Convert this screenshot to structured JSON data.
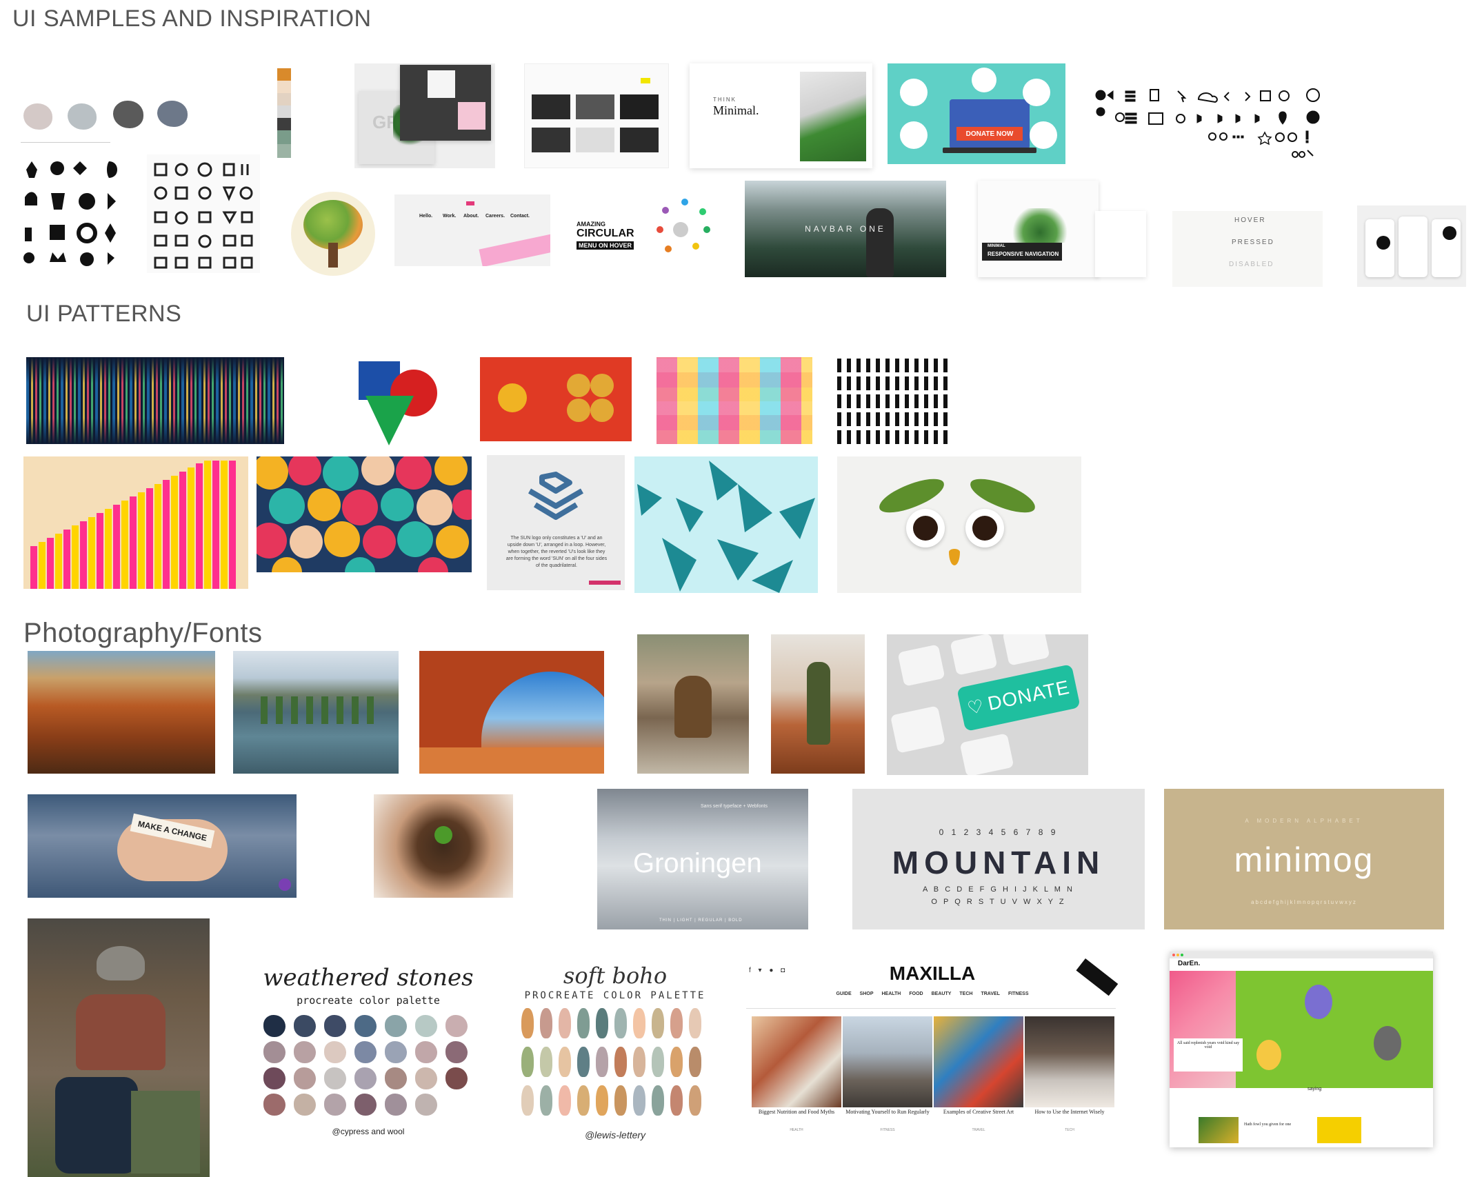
{
  "sections": {
    "samples": "UI SAMPLES AND INSPIRATION",
    "patterns": "UI PATTERNS",
    "photo": "Photography/Fonts"
  },
  "samples": {
    "minimal_title": "Minimal.",
    "minimal_kicker": "THINK",
    "donate_now": "DONATE NOW",
    "circular_menu": [
      "AMAZING",
      "CIRCULAR",
      "MENU ON HOVER"
    ],
    "navbar_one": "NAVBAR ONE",
    "responsive_nav": [
      "MINIMAL",
      "RESPONSIVE NAVIGATION"
    ],
    "button_states": [
      "HOVER",
      "PRESSED",
      "DISABLED"
    ],
    "hello_nav": [
      "Hello.",
      "Work.",
      "About.",
      "Careers.",
      "Contact."
    ],
    "gre_text": "GRE"
  },
  "patterns": {
    "sun_caption": "The SUN logo only constitutes a 'U' and an upside down 'U', arranged in a loop. However, when together, the reverted 'U's look like they are forming the word 'SUN' on all the four sides of the quadrilateral."
  },
  "photo": {
    "donate_key": "DONATE",
    "make_change": "MAKE A CHANGE",
    "groningen": "Groningen",
    "groningen_sub": "Sans serif typeface + Webfonts",
    "groningen_weights": "THIN  |  LIGHT  |  REGULAR  |  BOLD",
    "mountain_digits": "0 1 2 3 4 5 6 7 8 9",
    "mountain": "MOUNTAIN",
    "mountain_alpha1": "A B C D E F G H I J K L M N",
    "mountain_alpha2": "O P Q R S T U V W X Y Z",
    "minimog": "minimog",
    "minimog_sub": "A MODERN ALPHABET",
    "minimog_alpha": "abcdefghijklmnopqrstuvwxyz",
    "weathered_title": "weathered stones",
    "weathered_sub": "procreate color palette",
    "weathered_credit": "@cypress and wool",
    "boho_title": "soft boho",
    "boho_sub": "PROCREATE COLOR PALETTE",
    "boho_credit": "@lewis-lettery",
    "maxilla_title": "MAXILLA",
    "maxilla_nav": [
      "GUIDE",
      "SHOP",
      "HEALTH",
      "FOOD",
      "BEAUTY",
      "TECH",
      "TRAVEL",
      "FITNESS"
    ],
    "maxilla_cards": [
      {
        "title": "Biggest Nutrition and Food Myths",
        "tag": "HEALTH"
      },
      {
        "title": "Motivating Yourself to Run Regularly",
        "tag": "FITNESS"
      },
      {
        "title": "Examples of Creative Street Art",
        "tag": "TRAVEL"
      },
      {
        "title": "How to Use the Internet Wisely",
        "tag": "TECH"
      }
    ],
    "daren_logo": "DarEn.",
    "daren_card": "All said replenish years void kind say void",
    "daren_saying": "saying",
    "daren_bottom": "Hath fowl you given for one"
  },
  "colors": {
    "swatches_vertical": [
      "#d98a2b",
      "#f1dcc6",
      "#e2d2c2",
      "#d9d9d9",
      "#3d3d3d",
      "#7a9c8a",
      "#9bb3a4"
    ],
    "stone_blobs": [
      "#cfc5c3",
      "#b5bcc0",
      "#5c5c5c",
      "#6b7688"
    ],
    "weathered": [
      "#1f2e45",
      "#3b4a63",
      "#3e4b66",
      "#4d6a86",
      "#8aa4a8",
      "#b7c9c5",
      "#c9aeb0",
      "#a38e95",
      "#b8a1a3",
      "#dcc9c0",
      "#7c89a4",
      "#9aa3b5",
      "#c1a7a9",
      "#8b6a76",
      "#6e4a5a",
      "#b79c9a",
      "#c7c3c1",
      "#a9a2b0",
      "#a78a83",
      "#ccb7ad",
      "#7a4c4c",
      "#9c6b6b",
      "#c4b1a4",
      "#b3a3a9",
      "#7d5f6c",
      "#a0909a",
      "#bfb3b0"
    ],
    "boho": [
      "#d99a5b",
      "#c79a8e",
      "#e3b6a6",
      "#7f9c93",
      "#5a7c7c",
      "#9fb4b0",
      "#f3c4a4",
      "#c8b48d",
      "#d6a08c",
      "#e6c9b4",
      "#9ab07a",
      "#c4c8a8",
      "#e6c4a2",
      "#5f7f86",
      "#b5a2a8",
      "#c27d5a",
      "#d7b49a",
      "#b4c4b8",
      "#d9a26b",
      "#b98c6a",
      "#e1cdb8",
      "#9cb0a6",
      "#f0b9a8",
      "#d8ae74",
      "#e0a55c",
      "#c9955f",
      "#aab6c0",
      "#8aa39b",
      "#c48670",
      "#cfa077"
    ]
  }
}
